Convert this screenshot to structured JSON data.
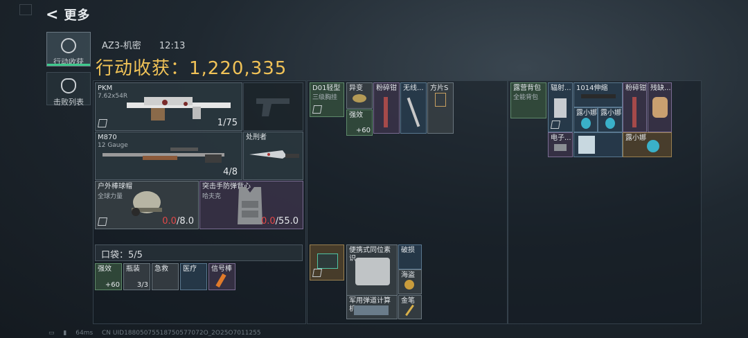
{
  "header": {
    "back_label": "更多"
  },
  "sidebar": {
    "tabs": [
      {
        "label": "行动收获",
        "active": true
      },
      {
        "label": "击败列表",
        "active": false
      }
    ]
  },
  "raid": {
    "map": "AZ3-机密",
    "time": "12:13",
    "total_label": "行动收获：1,220,335"
  },
  "gear": {
    "primary": {
      "name": "PKM",
      "caliber": "7.62x54R",
      "ammo": "1/75"
    },
    "secondary": {
      "name": "M870",
      "caliber": "12 Gauge",
      "ammo": "4/8"
    },
    "melee": {
      "name": "处刑者"
    },
    "helmet": {
      "name": "户外棒球帽",
      "sub": "全球力量",
      "durability_cur": "0.0",
      "durability_max": "/8.0"
    },
    "armor": {
      "name": "突击手防弹背心",
      "sub": "哈夫克",
      "durability_cur": "0.0",
      "durability_max": "/55.0"
    }
  },
  "pocket": {
    "label": "口袋：5/5",
    "items": [
      {
        "name": "强效",
        "count": "+60"
      },
      {
        "name": "瓶装",
        "count": "3/3"
      },
      {
        "name": "急救",
        "count": ""
      },
      {
        "name": "医疗",
        "count": ""
      },
      {
        "name": "信号棒",
        "count": ""
      }
    ]
  },
  "chest_rig": {
    "items": [
      {
        "name": "D01轻型",
        "sub": "三级胸挂"
      },
      {
        "name": "异变"
      },
      {
        "name": "粉碎钳"
      },
      {
        "name": "无线..."
      },
      {
        "name": "方片S"
      },
      {
        "name": "强效",
        "count": "+60"
      }
    ]
  },
  "backpack_center": {
    "items": [
      {
        "name": ""
      },
      {
        "name": "便携式同位素识..."
      },
      {
        "name": "破损"
      },
      {
        "name": "海盗"
      },
      {
        "name": "军用弹道计算机"
      },
      {
        "name": "金笔"
      }
    ]
  },
  "backpack_right": {
    "items": [
      {
        "name": "露营背包",
        "sub": "全能背包"
      },
      {
        "name": "辐射..."
      },
      {
        "name": "1014伸缩"
      },
      {
        "name": "粉碎钳"
      },
      {
        "name": "残缺..."
      },
      {
        "name": "露小娜"
      },
      {
        "name": "露小娜"
      },
      {
        "name": "电子..."
      },
      {
        "name": "露小娜"
      }
    ]
  },
  "footer": {
    "ping": "64ms",
    "uid": "CN UID18805075518750577072O_2O25O7011255"
  }
}
